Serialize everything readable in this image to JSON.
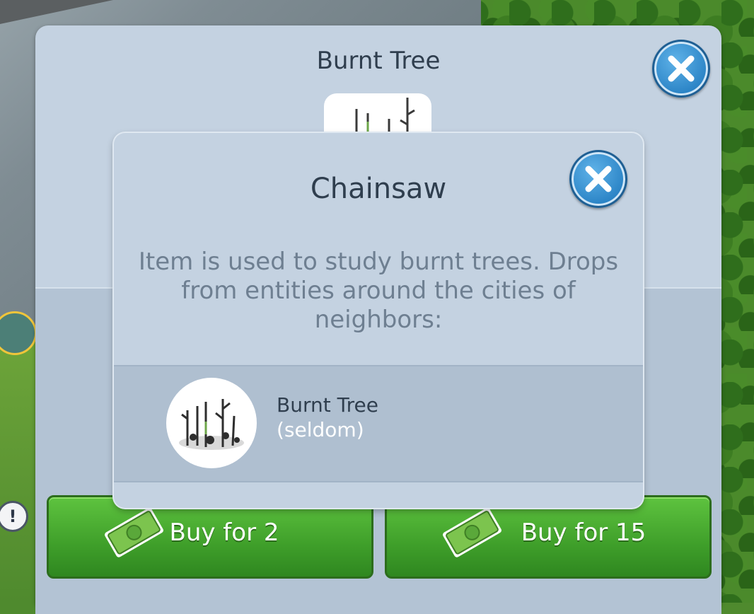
{
  "panel": {
    "title": "Burnt Tree",
    "buy_buttons": [
      {
        "label": "Buy for 2"
      },
      {
        "label": "Buy for 15"
      }
    ]
  },
  "dialog": {
    "title": "Chainsaw",
    "description": "Item is used to study burnt trees. Drops from entities around the cities of neighbors:",
    "source": {
      "name": "Burnt Tree",
      "rarity": "(seldom)"
    }
  },
  "icons": {
    "close": "close-icon",
    "cash": "cash-icon",
    "burnt_tree": "burnt-tree-icon",
    "alert": "exclamation-icon"
  },
  "alert_marker": "!",
  "colors": {
    "panel_bg": "#c4d2e1",
    "buy_green": "#3f9f2a",
    "close_blue": "#2b84c6",
    "title_text": "#2f3e4e",
    "desc_text": "#6e7f91"
  }
}
